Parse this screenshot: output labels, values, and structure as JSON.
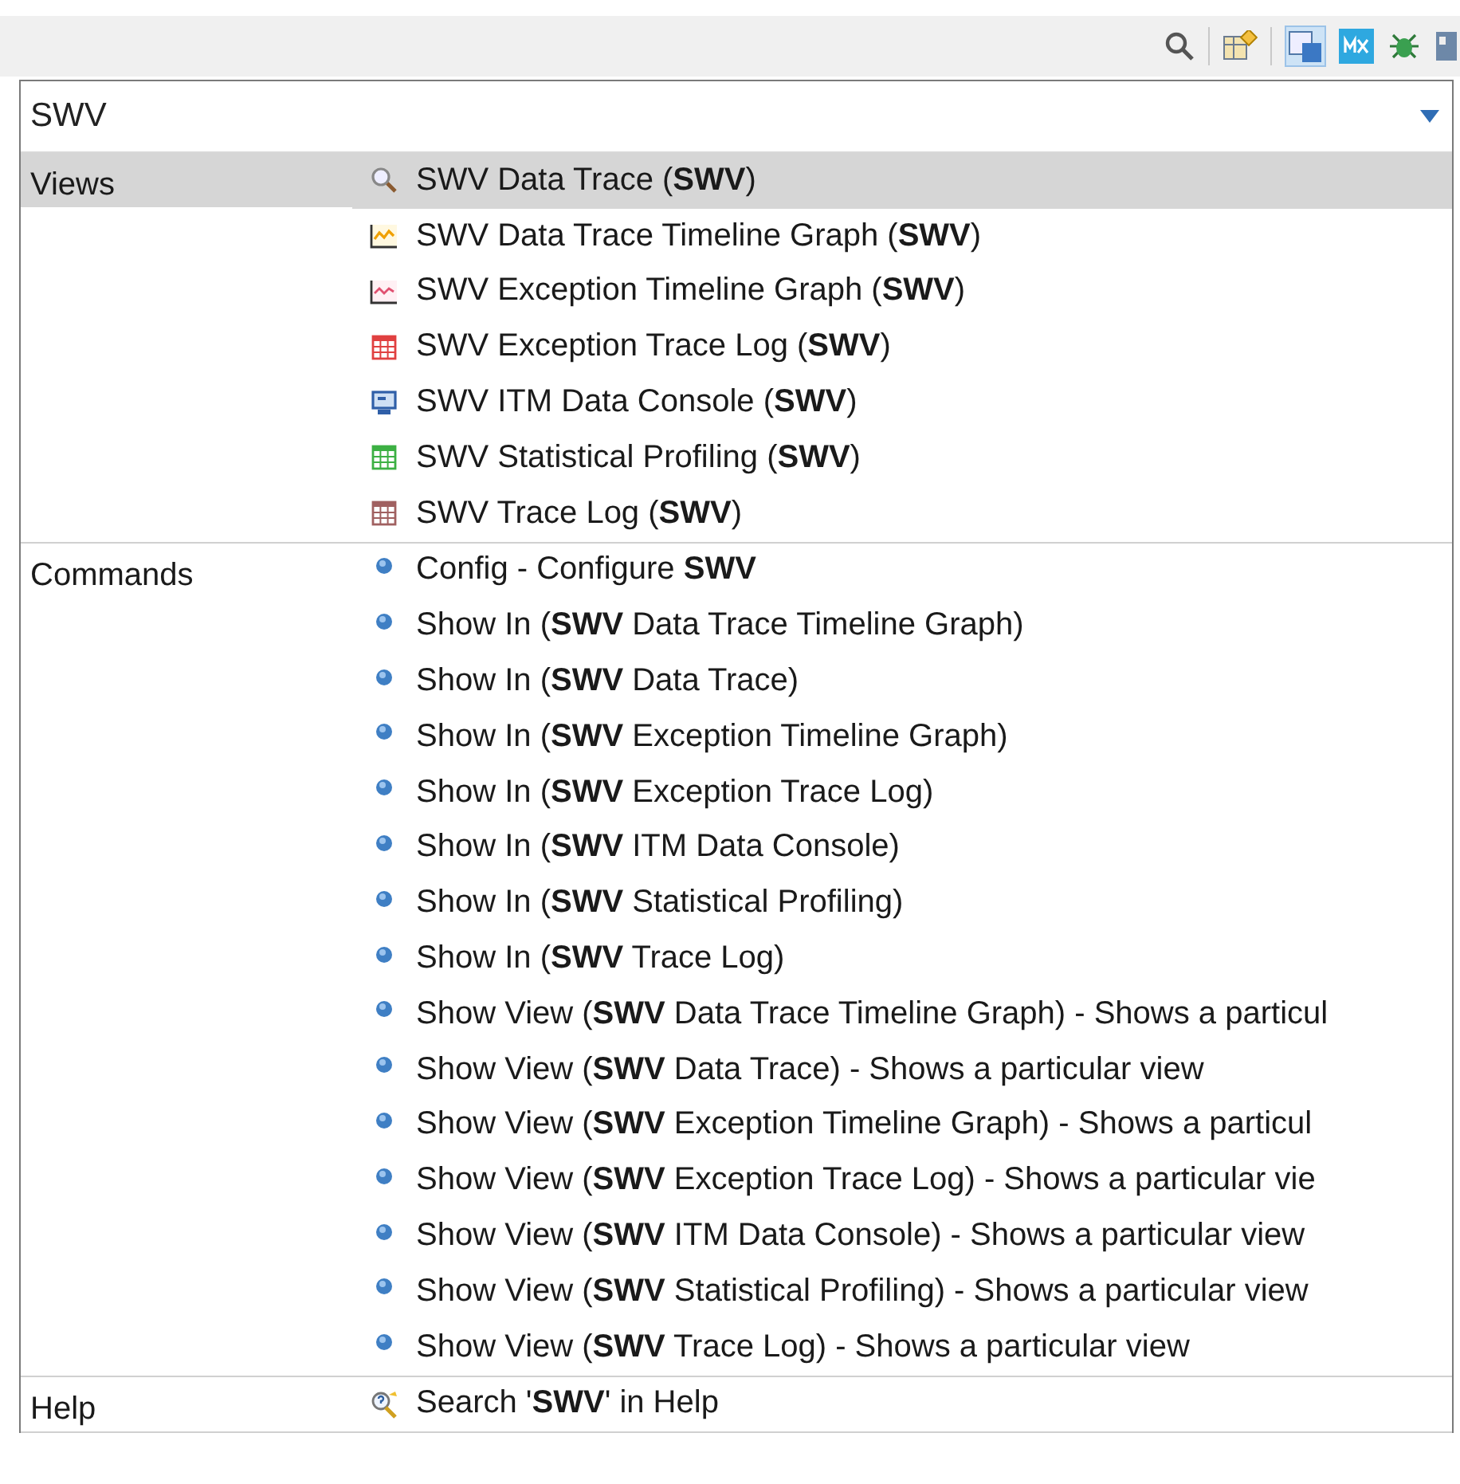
{
  "search": {
    "value": "SWV"
  },
  "groups": [
    {
      "label": "Views",
      "items": [
        {
          "kind": "search",
          "text": "SWV Data Trace (**SWV**)",
          "selected": true
        },
        {
          "kind": "graph",
          "text": "SWV Data Trace Timeline Graph (**SWV**)",
          "selected": false
        },
        {
          "kind": "exception-graph",
          "text": "SWV Exception Timeline Graph (**SWV**)",
          "selected": false
        },
        {
          "kind": "table",
          "color": "#e04040",
          "text": "SWV Exception Trace Log (**SWV**)",
          "selected": false
        },
        {
          "kind": "console",
          "text": "SWV ITM Data Console (**SWV**)",
          "selected": false
        },
        {
          "kind": "table",
          "color": "#3cb043",
          "text": "SWV Statistical Profiling (**SWV**)",
          "selected": false
        },
        {
          "kind": "table",
          "color": "#a06060",
          "text": "SWV Trace Log (**SWV**)",
          "selected": false
        }
      ]
    },
    {
      "label": "Commands",
      "items": [
        {
          "kind": "dot",
          "text": "Config - Configure **SWV**",
          "selected": false
        },
        {
          "kind": "dot",
          "text": "Show In (**SWV** Data Trace Timeline Graph)",
          "selected": false
        },
        {
          "kind": "dot",
          "text": "Show In (**SWV** Data Trace)",
          "selected": false
        },
        {
          "kind": "dot",
          "text": "Show In (**SWV** Exception Timeline Graph)",
          "selected": false
        },
        {
          "kind": "dot",
          "text": "Show In (**SWV** Exception Trace Log)",
          "selected": false
        },
        {
          "kind": "dot",
          "text": "Show In (**SWV** ITM Data Console)",
          "selected": false
        },
        {
          "kind": "dot",
          "text": "Show In (**SWV** Statistical Profiling)",
          "selected": false
        },
        {
          "kind": "dot",
          "text": "Show In (**SWV** Trace Log)",
          "selected": false
        },
        {
          "kind": "dot",
          "text": "Show View (**SWV** Data Trace Timeline Graph) - Shows a particul",
          "selected": false
        },
        {
          "kind": "dot",
          "text": "Show View (**SWV** Data Trace) - Shows a particular view",
          "selected": false
        },
        {
          "kind": "dot",
          "text": "Show View (**SWV** Exception Timeline Graph) - Shows a particul",
          "selected": false
        },
        {
          "kind": "dot",
          "text": "Show View (**SWV** Exception Trace Log) - Shows a particular vie",
          "selected": false
        },
        {
          "kind": "dot",
          "text": "Show View (**SWV** ITM Data Console) - Shows a particular view",
          "selected": false
        },
        {
          "kind": "dot",
          "text": "Show View (**SWV** Statistical Profiling) - Shows a particular view",
          "selected": false
        },
        {
          "kind": "dot",
          "text": "Show View (**SWV** Trace Log) - Shows a particular view",
          "selected": false
        }
      ]
    },
    {
      "label": "Help",
      "items": [
        {
          "kind": "help",
          "text": "Search '**SWV**' in Help",
          "selected": false
        }
      ]
    }
  ]
}
